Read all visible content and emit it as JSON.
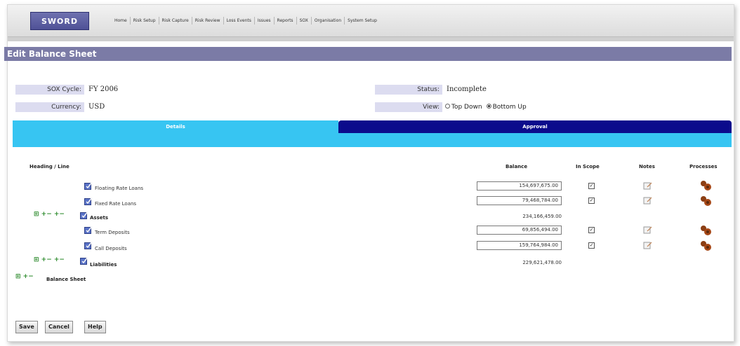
{
  "app": {
    "logo": "SWORD"
  },
  "nav": {
    "items": [
      "Home",
      "Risk Setup",
      "Risk Capture",
      "Risk Review",
      "Loss Events",
      "Issues",
      "Reports",
      "SOX",
      "Organisation",
      "System Setup"
    ]
  },
  "page": {
    "title": "Edit Balance Sheet"
  },
  "fields": {
    "sox_cycle_label": "SOX Cycle:",
    "sox_cycle_value": "FY 2006",
    "currency_label": "Currency:",
    "currency_value": "USD",
    "status_label": "Status:",
    "status_value": "Incomplete",
    "view_label": "View:",
    "view_top_down": "Top Down",
    "view_bottom_up": "Bottom Up",
    "view_selected": "Bottom Up"
  },
  "tabs": {
    "details": "Details",
    "approval": "Approval"
  },
  "table": {
    "headers": {
      "heading": "Heading / Line",
      "balance": "Balance",
      "in_scope": "In Scope",
      "notes": "Notes",
      "processes": "Processes"
    },
    "rows": [
      {
        "label": "Floating Rate Loans",
        "balance": "154,697,675.00",
        "in_scope": true
      },
      {
        "label": "Fixed Rate Loans",
        "balance": "79,468,784.00",
        "in_scope": true
      },
      {
        "label": "Assets",
        "total": "234,166,459.00"
      },
      {
        "label": "Term Deposits",
        "balance": "69,856,494.00",
        "in_scope": true
      },
      {
        "label": "Call Deposits",
        "balance": "159,764,984.00",
        "in_scope": true
      },
      {
        "label": "Liabilities",
        "total": "229,621,478.00"
      },
      {
        "label": "Balance Sheet"
      }
    ]
  },
  "buttons": {
    "save": "Save",
    "cancel": "Cancel",
    "help": "Help"
  },
  "colors": {
    "title_bar": "#7b7ba6",
    "tab_active": "#37c5f2",
    "tab_inactive": "#0b0b8c",
    "label_bg": "#dcdcf0",
    "logo": "#5558a0"
  }
}
